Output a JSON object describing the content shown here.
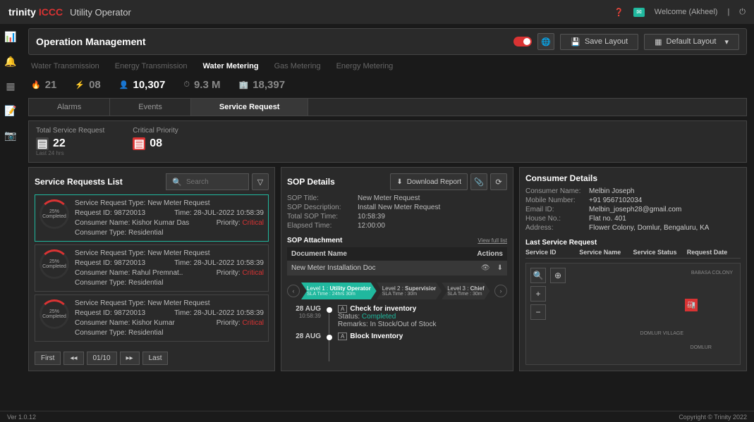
{
  "header": {
    "brand1": "trinity",
    "brand2": "ICCC",
    "product": "Utility Operator",
    "welcome": "Welcome (Akheel)"
  },
  "page": {
    "title": "Operation Management",
    "save_layout": "Save Layout",
    "default_layout": "Default Layout"
  },
  "category_tabs": [
    "Water Transmission",
    "Energy Transmission",
    "Water Metering",
    "Gas Metering",
    "Energy Metering"
  ],
  "category_active": 2,
  "stats": [
    {
      "icon": "🔥",
      "value": "21"
    },
    {
      "icon": "⚡",
      "value": "08"
    },
    {
      "icon": "👤",
      "value": "10,307"
    },
    {
      "icon": "⏱",
      "value": "9.3 M"
    },
    {
      "icon": "🏢",
      "value": "18,397"
    }
  ],
  "sub_tabs": [
    "Alarms",
    "Events",
    "Service Request"
  ],
  "sub_active": 2,
  "counters": {
    "total_lbl": "Total Service Request",
    "total": "22",
    "total_sub": "Last 24 hrs",
    "crit_lbl": "Critical Priority",
    "crit": "08"
  },
  "list": {
    "title": "Service Requests List",
    "search_ph": "Search",
    "items": [
      {
        "pct": "25%",
        "pct_lbl": "Completed",
        "type": "Service Request Type: New Meter Request",
        "req": "Request ID: 98720013",
        "time": "Time: 28-JUL-2022 10:58:39",
        "name": "Consumer Name: Kishor Kumar Das",
        "prio_lbl": "Priority:",
        "prio": "Critical",
        "ctype": "Consumer Type: Residential",
        "sel": true
      },
      {
        "pct": "25%",
        "pct_lbl": "Completed",
        "type": "Service Request Type: New Meter Request",
        "req": "Request ID: 98720013",
        "time": "Time: 28-JUL-2022 10:58:39",
        "name": "Consumer Name: Rahul Premnat..",
        "prio_lbl": "Priority:",
        "prio": "Critical",
        "ctype": "Consumer Type: Residential",
        "sel": false
      },
      {
        "pct": "25%",
        "pct_lbl": "Completed",
        "type": "Service Request Type: New Meter Request",
        "req": "Request ID: 98720013",
        "time": "Time: 28-JUL-2022 10:58:39",
        "name": "Consumer Name: Kishor Kumar",
        "prio_lbl": "Priority:",
        "prio": "Critical",
        "ctype": "Consumer Type: Residential",
        "sel": false
      }
    ],
    "pager": {
      "first": "First",
      "page": "01/10",
      "last": "Last"
    }
  },
  "sop": {
    "title": "SOP Details",
    "download": "Download Report",
    "meta": [
      {
        "k": "SOP Title",
        "v": "New Meter Request"
      },
      {
        "k": "SOP Description",
        "v": "Install New Meter Request"
      },
      {
        "k": "Total SOP Time",
        "v": "10:58:39"
      },
      {
        "k": "Elapsed Time",
        "v": "12:00:00"
      }
    ],
    "att_title": "SOP Attachment",
    "view_full": "View full list",
    "doc_hdr_name": "Document Name",
    "doc_hdr_act": "Actions",
    "doc_name": "New Meter Installation Doc",
    "steps": [
      {
        "lvl": "Level 1 :",
        "role": "Utility Operator",
        "sla": "SLA Time : 24hrs 30m",
        "active": true
      },
      {
        "lvl": "Level 2 :",
        "role": "Supervisior",
        "sla": "SLA Time : 30m",
        "active": false
      },
      {
        "lvl": "Level 3 :",
        "role": "Chief",
        "sla": "SLA Time : 30m",
        "active": false
      }
    ],
    "timeline": [
      {
        "date": "28 AUG",
        "time": "10:58:39",
        "badge": "A",
        "title": "Check for inventory",
        "status_lbl": "Status:",
        "status": "Completed",
        "remarks": "Remarks: In Stock/Out of Stock"
      },
      {
        "date": "28 AUG",
        "time": "",
        "badge": "A",
        "title": "Block Inventory",
        "status_lbl": "",
        "status": "",
        "remarks": ""
      }
    ]
  },
  "consumer": {
    "title": "Consumer Details",
    "meta": [
      {
        "k": "Consumer Name",
        "v": "Melbin Joseph"
      },
      {
        "k": "Mobile Number",
        "v": "+91 9567102034"
      },
      {
        "k": "Email ID",
        "v": "Melbin_joseph28@gmail.com"
      },
      {
        "k": "House No.",
        "v": "Flat no. 401"
      },
      {
        "k": "Address",
        "v": "Flower Colony, Domlur, Bengaluru, KA"
      }
    ],
    "lsr_title": "Last Service Request",
    "lsr_cols": [
      "Service ID",
      "Service Name",
      "Service Status",
      "Request Date"
    ]
  },
  "footer": {
    "ver": "Ver 1.0.12",
    "copy": "Copyright © Trinity 2022"
  }
}
